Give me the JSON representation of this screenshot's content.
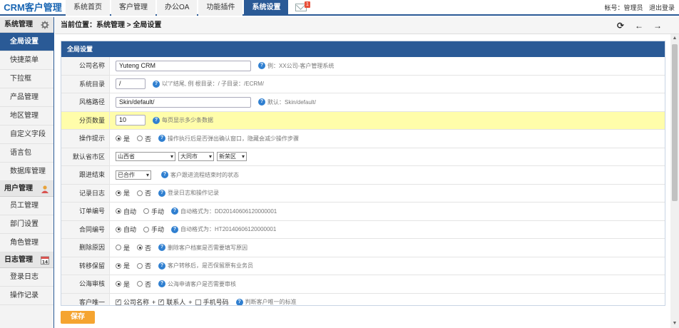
{
  "app": {
    "logo": "CRM客户管理"
  },
  "nav": [
    "系统首页",
    "客户管理",
    "办公OA",
    "功能插件",
    "系统设置"
  ],
  "mail_badge": "1",
  "user": {
    "account": "帐号：管理员",
    "logout": "退出登录"
  },
  "sidebar": {
    "groups": [
      {
        "title": "系统管理",
        "items": [
          "全局设置",
          "快捷菜单",
          "下拉框",
          "产品管理",
          "地区管理",
          "自定义字段",
          "语言包",
          "数据库管理"
        ]
      },
      {
        "title": "用户管理",
        "items": [
          "员工管理",
          "部门设置",
          "角色管理"
        ]
      },
      {
        "title": "日志管理",
        "items": [
          "登录日志",
          "操作记录"
        ]
      }
    ],
    "log_icon_text": "14"
  },
  "breadcrumb": "当前位置：系统管理 > 全局设置",
  "panel_title": "全局设置",
  "rows": {
    "company": {
      "label": "公司名称",
      "value": "Yuteng CRM",
      "hint": "例：XX公司-客户管理系统"
    },
    "sysdir": {
      "label": "系统目录",
      "value": "/",
      "hint": "以\"/\"结尾, 例 根目录：/     子目录：/ECRM/"
    },
    "style": {
      "label": "风格路径",
      "value": "Skin/default/",
      "hint": "默认：Skin/default/"
    },
    "pagesize": {
      "label": "分页数量",
      "value": "10",
      "hint": "每页显示多少条数据"
    },
    "tips": {
      "label": "操作提示",
      "opt_yes": "是",
      "opt_no": "否",
      "hint": "操作执行后是否弹出确认窗口，隐藏会减少操作步骤"
    },
    "region": {
      "label": "默认省市区",
      "province": "山西省",
      "city": "大同市",
      "district": "新荣区"
    },
    "follow": {
      "label": "跟进结束",
      "value": "已合作",
      "hint": "客户跟进流程结束时的状态"
    },
    "log": {
      "label": "记录日志",
      "opt_yes": "是",
      "opt_no": "否",
      "hint": "登录日志和操作记录"
    },
    "order_no": {
      "label": "订单编号",
      "opt_auto": "自动",
      "opt_manual": "手动",
      "hint": "自动格式为：DD20140606120000001"
    },
    "contract_no": {
      "label": "合同编号",
      "opt_auto": "自动",
      "opt_manual": "手动",
      "hint": "自动格式为：HT20140606120000001"
    },
    "delete_reason": {
      "label": "删除原因",
      "opt_yes": "是",
      "opt_no": "否",
      "hint": "删除客户档案是否需要填写原因"
    },
    "transfer_keep": {
      "label": "转移保留",
      "opt_yes": "是",
      "opt_no": "否",
      "hint": "客户转移后，是否保留原有业务员"
    },
    "sea_audit": {
      "label": "公海审核",
      "opt_yes": "是",
      "opt_no": "否",
      "hint": "公海申请客户是否需要审核"
    },
    "unique": {
      "label": "客户唯一",
      "c1": "公司名称",
      "c2": "联系人",
      "c3": "手机号码",
      "plus": "+",
      "hint": "判断客户唯一的标准"
    }
  },
  "save_label": "保存",
  "colors": {
    "nav_active": "#2a5a96",
    "highlight_row": "#fffdaa",
    "save": "#f5a430",
    "help": "#2f7fd0"
  }
}
